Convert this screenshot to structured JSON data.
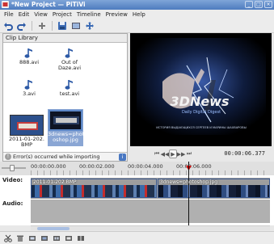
{
  "window": {
    "title": "*New Project — PiTiVi"
  },
  "menu": [
    "File",
    "Edit",
    "View",
    "Project",
    "Timeline",
    "Preview",
    "Help"
  ],
  "toolbar": {
    "icons": [
      "undo-icon",
      "redo-icon",
      "add-icon",
      "save-icon",
      "render-icon",
      "move-icon"
    ]
  },
  "library": {
    "header": "Clip Library",
    "clips": [
      {
        "name": "888.avi",
        "type": "audio"
      },
      {
        "name": "Out of\nDaze.avi",
        "type": "audio"
      },
      {
        "name": "3.avi",
        "type": "audio"
      },
      {
        "name": "test.avi",
        "type": "audio"
      },
      {
        "name": "2011-01-202.\nBMP",
        "type": "image"
      },
      {
        "name": "3dnews=phot\noshop.jpg",
        "type": "image",
        "selected": true
      }
    ],
    "error": "Error(s) occurred while importing"
  },
  "viewer": {
    "logo_text": "3DNews",
    "subtitle": "Daily Digital Digest",
    "footer": "ИСТОРИЯ ВЫДАЮЩИХСЯ СЕРГЕЕВ И МАРИНЫ ШАХВАРОВЫ"
  },
  "transport": {
    "timecode": "00:00:06.377"
  },
  "timeline": {
    "ticks": [
      "00:00:00.000",
      "00:00:02.000",
      "00:00:04.000",
      "00:00:06.000"
    ],
    "video_label": "Video:",
    "audio_label": "Audio:",
    "clips": [
      {
        "name": "2011-01-202.BMP"
      },
      {
        "name": "3dnews=photoshop.jpg"
      }
    ]
  },
  "colors": {
    "accent": "#5c87c7",
    "title": "#4d7bbf",
    "track_bg": "#9e9e9e",
    "playhead": "#111111"
  }
}
